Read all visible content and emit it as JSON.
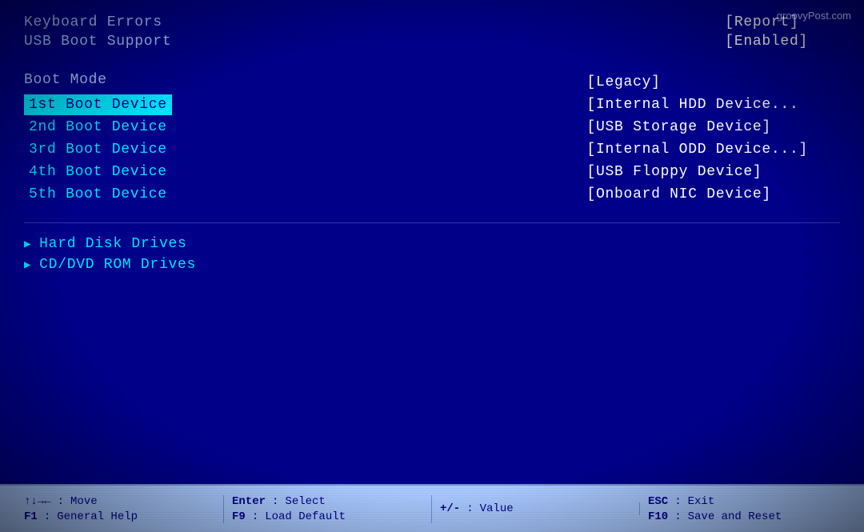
{
  "watermark": {
    "text": "groovyPost.com"
  },
  "top_items": {
    "left": [
      {
        "label": "Keyboard Errors"
      },
      {
        "label": "USB Boot Support"
      }
    ],
    "right": [
      {
        "value": "[Report]"
      },
      {
        "value": "[Enabled]"
      }
    ]
  },
  "boot_section": {
    "mode_label": "Boot Mode",
    "mode_value": "[Legacy]",
    "devices": [
      {
        "label": "1st Boot Device",
        "value": "[Internal HDD Device...",
        "selected": true
      },
      {
        "label": "2nd Boot Device",
        "value": "[USB Storage Device]",
        "selected": false
      },
      {
        "label": "3rd Boot Device",
        "value": "[Internal ODD Device...]",
        "selected": false
      },
      {
        "label": "4th Boot Device",
        "value": "[USB Floppy Device]",
        "selected": false
      },
      {
        "label": "5th Boot Device",
        "value": "[Onboard NIC Device]",
        "selected": false
      }
    ]
  },
  "drives": [
    {
      "label": "Hard Disk Drives"
    },
    {
      "label": "CD/DVD ROM Drives"
    }
  ],
  "status_bar": {
    "columns": [
      {
        "lines": [
          {
            "key": "↑↓→←",
            "colon": ":",
            "desc": "Move"
          },
          {
            "key": "F1",
            "colon": ":",
            "desc": "General Help"
          }
        ]
      },
      {
        "lines": [
          {
            "key": "Enter",
            "colon": ":",
            "desc": "Select"
          },
          {
            "key": "F9",
            "colon": ":",
            "desc": "Load Default"
          }
        ]
      },
      {
        "lines": [
          {
            "key": "+/-",
            "colon": ":",
            "desc": "Value"
          },
          {
            "key": "",
            "colon": "",
            "desc": ""
          }
        ]
      },
      {
        "lines": [
          {
            "key": "ESC",
            "colon": ":",
            "desc": "Exit"
          },
          {
            "key": "F10",
            "colon": ":",
            "desc": "Save and Reset"
          }
        ]
      }
    ]
  }
}
